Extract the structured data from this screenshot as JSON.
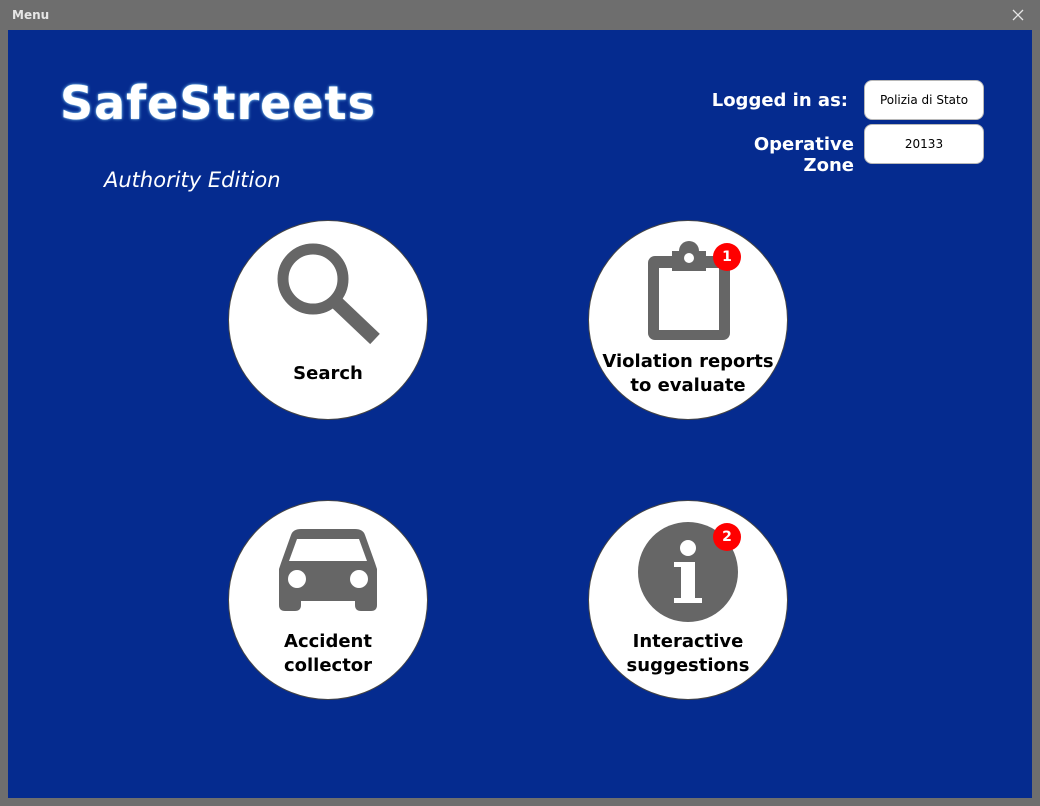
{
  "window": {
    "title": "Menu"
  },
  "logo": {
    "main": "SafeStreets",
    "sub": "Authority Edition"
  },
  "header": {
    "logged_in_label": "Logged in as:",
    "logged_in_value": "Polizia di Stato",
    "zone_label": "Operative Zone",
    "zone_value": "20133"
  },
  "tiles": [
    {
      "label_line1": "Search",
      "label_line2": "",
      "icon": "search-icon"
    },
    {
      "label_line1": "Violation reports",
      "label_line2": "to evaluate",
      "icon": "clipboard-icon",
      "badge": "1"
    },
    {
      "label_line1": "Accident",
      "label_line2": "collector",
      "icon": "car-icon"
    },
    {
      "label_line1": "Interactive",
      "label_line2": "suggestions",
      "icon": "info-icon",
      "badge": "2"
    }
  ],
  "colors": {
    "background": "#052b8f",
    "badge": "#ff0000",
    "icon": "#666666",
    "frame": "#6e6e6e"
  }
}
